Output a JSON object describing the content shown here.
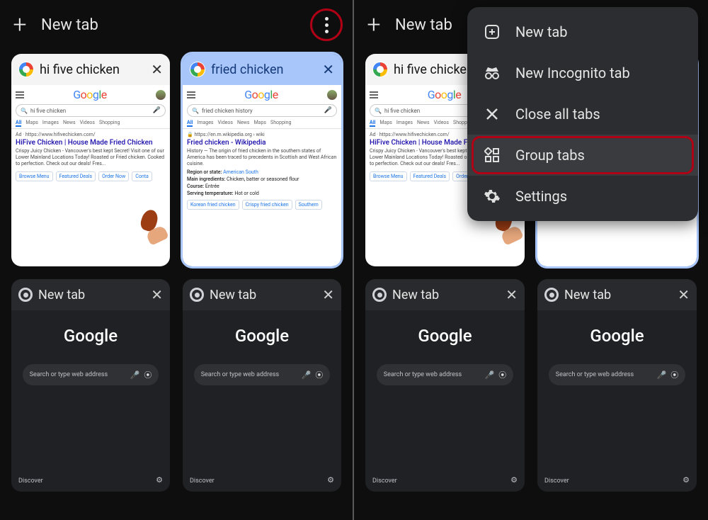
{
  "left": {
    "toolbar": {
      "new_tab": "New tab"
    },
    "tabs": [
      {
        "id": "t1",
        "title": "hi five chicken",
        "selected": false,
        "search_query": "hi five chicken",
        "search_tabs": [
          "All",
          "Maps",
          "Images",
          "News",
          "Videos",
          "Shopping"
        ],
        "ad_line": "Ad · https://www.hifivechicken.com/",
        "result_title": "HiFive Chicken | House Made Fried Chicken",
        "result_body": "Crispy Juicy Chicken - Vancouver's best kept Secret! Visit one of our Lower Mainland Locations Today! Roasted or Fried chicken. Cooked to perfection. Check out our deals! Fres...",
        "sitelinks": [
          "Browse Menu",
          "Featured Deals",
          "Order Now",
          "Conta"
        ]
      },
      {
        "id": "t2",
        "title": "fried chicken",
        "selected": true,
        "search_query": "fried chicken history",
        "search_tabs": [
          "All",
          "Images",
          "Videos",
          "News",
          "Maps",
          "Shopping"
        ],
        "ad_line": "🔒 https://en.m.wikipedia.org › wiki",
        "result_title": "Fried chicken - Wikipedia",
        "result_body": "History — The origin of fried chicken in the southern states of America has been traced to precedents in Scottish and West African cuisine.",
        "kv": [
          {
            "k": "Region or state:",
            "v": "American South",
            "link": true
          },
          {
            "k": "Main ingredients:",
            "v": "Chicken, batter or seasoned flour"
          },
          {
            "k": "Course:",
            "v": "Entrée"
          },
          {
            "k": "Serving temperature:",
            "v": "Hot or cold"
          }
        ],
        "sitelinks": [
          "Korean fried chicken",
          "Crispy fried chicken",
          "Southern"
        ]
      },
      {
        "id": "t3",
        "title": "New tab",
        "dark": true,
        "placeholder": "Search or type web address",
        "discover": "Discover"
      },
      {
        "id": "t4",
        "title": "New tab",
        "dark": true,
        "placeholder": "Search or type web address",
        "discover": "Discover"
      }
    ]
  },
  "right": {
    "toolbar": {
      "new_tab": "New tab"
    },
    "menu": {
      "items": [
        {
          "icon": "plus-box",
          "label": "New tab"
        },
        {
          "icon": "incognito",
          "label": "New Incognito tab"
        },
        {
          "icon": "close",
          "label": "Close all tabs"
        },
        {
          "icon": "grid",
          "label": "Group tabs",
          "highlight": true
        },
        {
          "icon": "gear",
          "label": "Settings"
        }
      ]
    },
    "tabs_ref": "same as left"
  },
  "glyphs": {
    "google": "Google"
  }
}
